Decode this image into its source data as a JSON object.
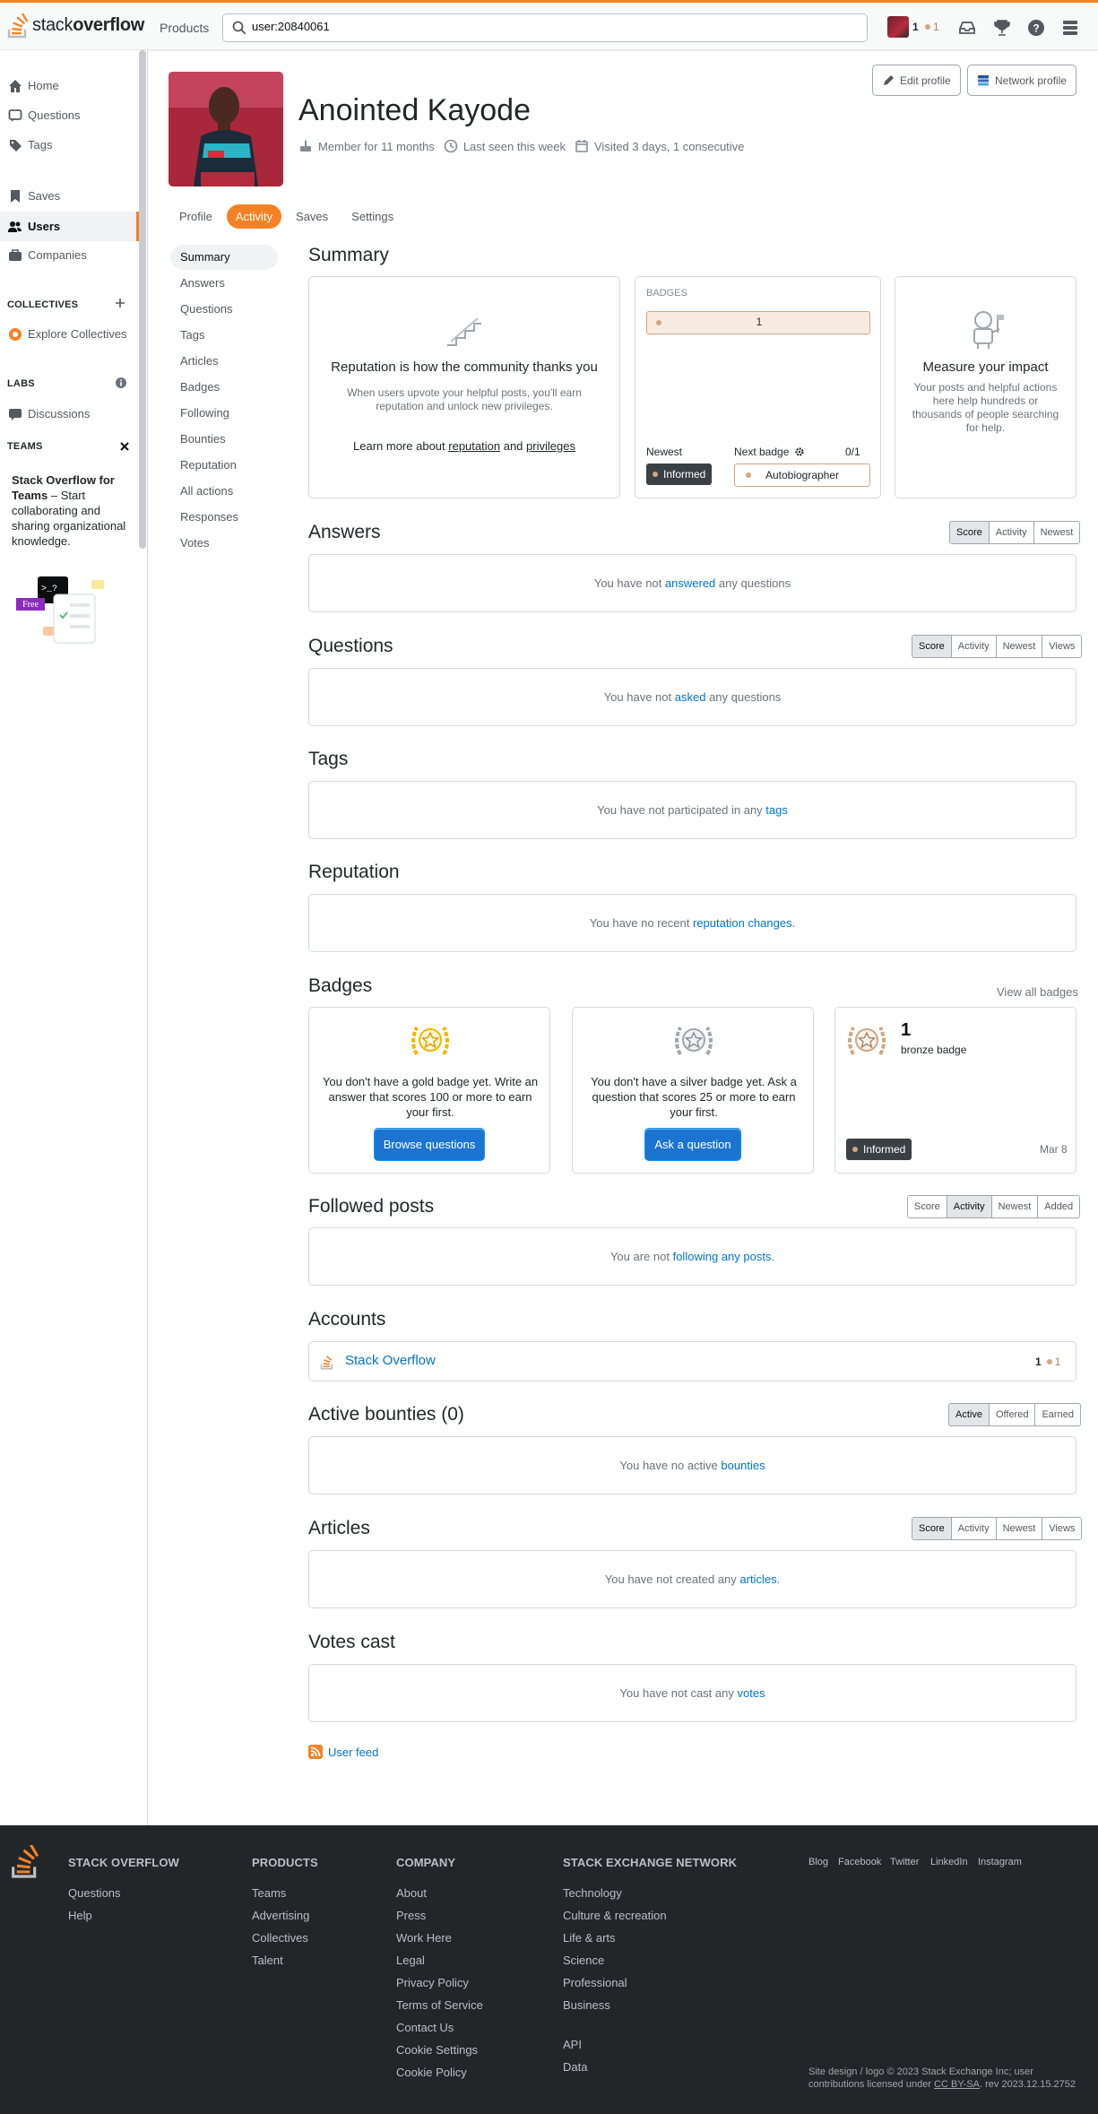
{
  "header": {
    "logo_light": "stack",
    "logo_bold": "overflow",
    "products": "Products",
    "search_value": "user:20840061",
    "reputation": "1",
    "bronze_count": "1"
  },
  "sidebar": {
    "items": [
      {
        "label": "Home"
      },
      {
        "label": "Questions"
      },
      {
        "label": "Tags"
      },
      {
        "label": "Saves"
      },
      {
        "label": "Users"
      },
      {
        "label": "Companies"
      }
    ],
    "collectives_head": "COLLECTIVES",
    "explore_collectives": "Explore Collectives",
    "labs_head": "LABS",
    "discussions": "Discussions",
    "teams_head": "TEAMS",
    "teams_title": "Stack Overflow for Teams",
    "teams_text": " – Start collaborating and sharing organizational knowledge.",
    "free_label": "Free"
  },
  "profile": {
    "name": "Anointed Kayode",
    "member_for": "Member for 11 months",
    "last_seen": "Last seen this week",
    "visited": "Visited 3 days, 1 consecutive",
    "edit_profile": "Edit profile",
    "network_profile": "Network profile",
    "tabs": [
      "Profile",
      "Activity",
      "Saves",
      "Settings"
    ]
  },
  "activity_menu": [
    "Summary",
    "Answers",
    "Questions",
    "Tags",
    "Articles",
    "Badges",
    "Following",
    "Bounties",
    "Reputation",
    "All actions",
    "Responses",
    "Votes"
  ],
  "summary": {
    "title": "Summary",
    "rep_heading": "Reputation is how the community thanks you",
    "rep_text": "When users upvote your helpful posts, you'll earn reputation and unlock new privileges.",
    "learn_more_pre": "Learn more about",
    "learn_reputation": "reputation",
    "learn_and": "and",
    "learn_privileges": "privileges",
    "badges_label": "BADGES",
    "bronze_total": "1",
    "newest_label": "Newest",
    "newest_badge": "Informed",
    "next_badge_label": "Next badge",
    "next_badge_progress": "0/1",
    "next_badge": "Autobiographer",
    "impact_heading": "Measure your impact",
    "impact_text": "Your posts and helpful actions here help hundreds or thousands of people searching for help."
  },
  "answers": {
    "title": "Answers",
    "filters": [
      "Score",
      "Activity",
      "Newest"
    ],
    "pre": "You have not",
    "link": "answered",
    "post": "any questions"
  },
  "questions": {
    "title": "Questions",
    "filters": [
      "Score",
      "Activity",
      "Newest",
      "Views"
    ],
    "pre": "You have not",
    "link": "asked",
    "post": "any questions"
  },
  "tags": {
    "title": "Tags",
    "pre": "You have not participated in any",
    "link": "tags"
  },
  "reputation": {
    "title": "Reputation",
    "pre": "You have no recent",
    "link": "reputation changes",
    "post": "."
  },
  "badges": {
    "title": "Badges",
    "view_all": "View all badges",
    "gold_text": "You don't have a gold badge yet. Write an answer that scores 100 or more to earn your first.",
    "gold_button": "Browse questions",
    "silver_text": "You don't have a silver badge yet. Ask a question that scores 25 or more to earn your first.",
    "silver_button": "Ask a question",
    "bronze_count": "1",
    "bronze_label": "bronze badge",
    "bronze_badge": "Informed",
    "bronze_date": "Mar 8"
  },
  "followed": {
    "title": "Followed posts",
    "filters": [
      "Score",
      "Activity",
      "Newest",
      "Added"
    ],
    "pre": "You are not",
    "link": "following any posts",
    "post": "."
  },
  "accounts": {
    "title": "Accounts",
    "site": "Stack Overflow",
    "rep": "1",
    "bronze": "1"
  },
  "bounties": {
    "title": "Active bounties (0)",
    "filters": [
      "Active",
      "Offered",
      "Earned"
    ],
    "pre": "You have no active",
    "link": "bounties"
  },
  "articles": {
    "title": "Articles",
    "filters": [
      "Score",
      "Activity",
      "Newest",
      "Views"
    ],
    "pre": "You have not created any",
    "link": "articles",
    "post": "."
  },
  "votes": {
    "title": "Votes cast",
    "pre": "You have not cast any",
    "link": "votes"
  },
  "user_feed": "User feed",
  "footer": {
    "col1_head": "STACK OVERFLOW",
    "col1": [
      "Questions",
      "Help"
    ],
    "col2_head": "PRODUCTS",
    "col2": [
      "Teams",
      "Advertising",
      "Collectives",
      "Talent"
    ],
    "col3_head": "COMPANY",
    "col3": [
      "About",
      "Press",
      "Work Here",
      "Legal",
      "Privacy Policy",
      "Terms of Service",
      "Contact Us",
      "Cookie Settings",
      "Cookie Policy"
    ],
    "col4_head": "STACK EXCHANGE NETWORK",
    "col4": [
      "Technology",
      "Culture & recreation",
      "Life & arts",
      "Science",
      "Professional",
      "Business"
    ],
    "col4b": [
      "API",
      "Data"
    ],
    "social": [
      "Blog",
      "Facebook",
      "Twitter",
      "LinkedIn",
      "Instagram"
    ],
    "copyright1": "Site design / logo © 2023 Stack Exchange Inc; user",
    "copyright2_pre": "contributions licensed under",
    "copyright2_link": "CC BY-SA",
    "copyright2_post": ". rev 2023.12.15.2752"
  },
  "colors": {
    "accent": "#f48225",
    "link": "#0074cc",
    "bronze": "#d1a684",
    "footer_bg": "#232629"
  }
}
